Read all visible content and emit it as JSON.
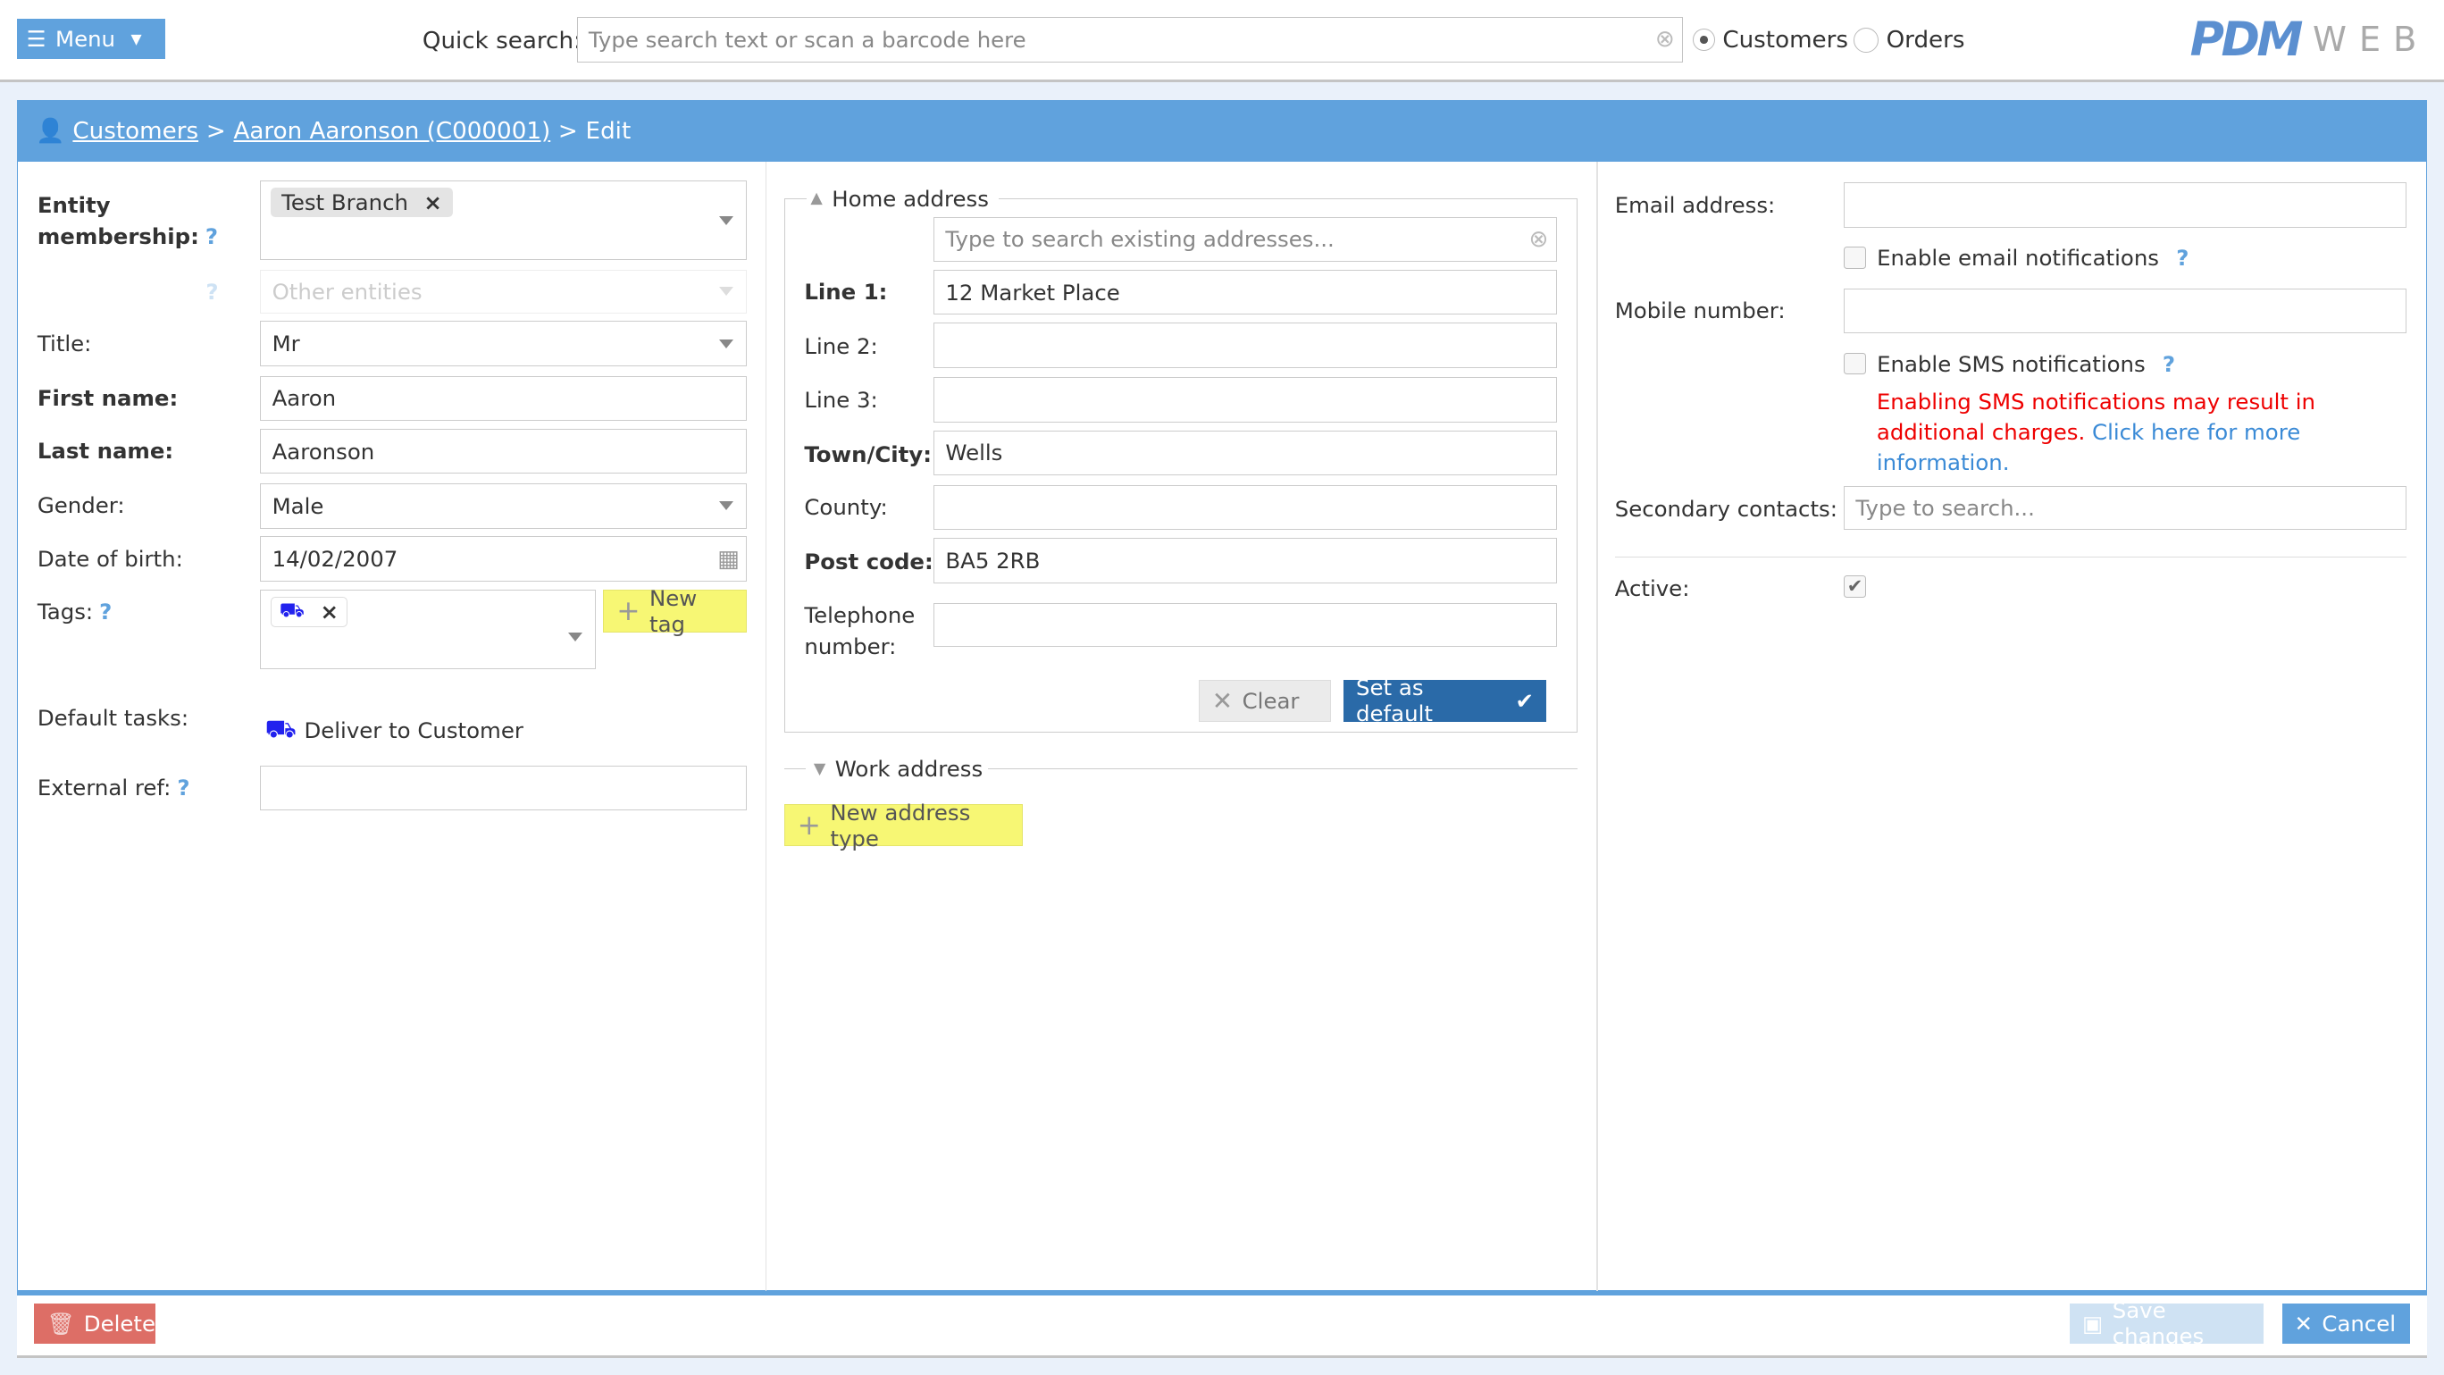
{
  "header": {
    "menu_label": "Menu",
    "quick_search_label": "Quick search:",
    "quick_search_placeholder": "Type search text or scan a barcode here",
    "radio_customers": "Customers",
    "radio_orders": "Orders",
    "selected_scope": "Customers",
    "logo_text": "PDM",
    "logo_suffix": "WEB"
  },
  "breadcrumb": {
    "items": [
      "Customers",
      "Aaron Aaronson (C000001)"
    ],
    "current": "Edit",
    "separator": ">"
  },
  "left": {
    "entity_label": "Entity membership:",
    "entity_chip": "Test Branch",
    "other_entities_placeholder": "Other entities",
    "title_label": "Title:",
    "title_value": "Mr",
    "first_name_label": "First name:",
    "first_name_value": "Aaron",
    "last_name_label": "Last name:",
    "last_name_value": "Aaronson",
    "gender_label": "Gender:",
    "gender_value": "Male",
    "dob_label": "Date of birth:",
    "dob_value": "14/02/2007",
    "tags_label": "Tags:",
    "new_tag_label": "New tag",
    "default_tasks_label": "Default tasks:",
    "default_task": "Deliver to Customer",
    "external_ref_label": "External ref:",
    "external_ref_value": ""
  },
  "middle": {
    "home_legend": "Home address",
    "address_search_placeholder": "Type to search existing addresses...",
    "line1_label": "Line 1:",
    "line1_value": "12 Market Place",
    "line2_label": "Line 2:",
    "line2_value": "",
    "line3_label": "Line 3:",
    "line3_value": "",
    "town_label": "Town/City:",
    "town_value": "Wells",
    "county_label": "County:",
    "county_value": "",
    "postcode_label": "Post code:",
    "postcode_value": "BA5 2RB",
    "telephone_label_1": "Telephone",
    "telephone_label_2": "number:",
    "telephone_value": "",
    "clear_label": "Clear",
    "set_default_label": "Set as default",
    "work_legend": "Work address",
    "new_address_type_label": "New address type"
  },
  "right": {
    "email_label": "Email address:",
    "email_value": "",
    "email_notif_label": "Enable email notifications",
    "mobile_label": "Mobile number:",
    "mobile_value": "",
    "sms_notif_label": "Enable SMS notifications",
    "sms_warning": "Enabling SMS notifications may result in additional charges.",
    "sms_link": "Click here for more information.",
    "secondary_label": "Secondary contacts:",
    "secondary_placeholder": "Type to search...",
    "active_label": "Active:",
    "active_checked": true
  },
  "footer": {
    "delete_label": "Delete",
    "save_label": "Save changes",
    "cancel_label": "Cancel"
  },
  "colors": {
    "accent": "#60a2dd",
    "danger": "#dd6e66",
    "warning_text": "#ee0000",
    "highlight": "#f7f774",
    "primary_dark": "#2a6aa8"
  }
}
